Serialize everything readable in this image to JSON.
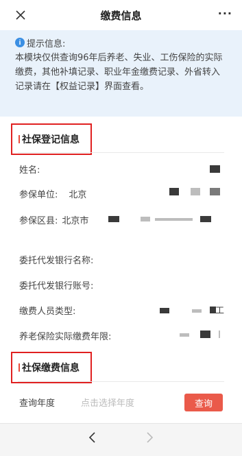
{
  "navbar": {
    "title": "缴费信息",
    "more": "···"
  },
  "notice": {
    "label": "提示信息:",
    "text": "本模块仅供查询96年后养老、失业、工伤保险的实际缴费，其他补填记录、职业年金缴费记录、外省转入记录请在【权益记录】界面查看。"
  },
  "registration": {
    "title": "社保登记信息",
    "fields": {
      "name": "姓名:",
      "unit": "参保单位:",
      "unit_value": "北京",
      "district": "参保区县:",
      "district_value": "北京市",
      "bank_name": "委托代发银行名称:",
      "bank_account": "委托代发银行账号:",
      "payer_type": "缴费人员类型:",
      "payer_type_value": "工",
      "pension_years": "养老保险实际缴费年限:"
    }
  },
  "payment": {
    "title": "社保缴费信息",
    "query_label": "查询年度",
    "query_placeholder": "点击选择年度",
    "query_button": "查询"
  },
  "colors": {
    "accent": "#ea5a4a",
    "notice_bg": "#e9f2fb",
    "highlight_box": "#e02020"
  }
}
